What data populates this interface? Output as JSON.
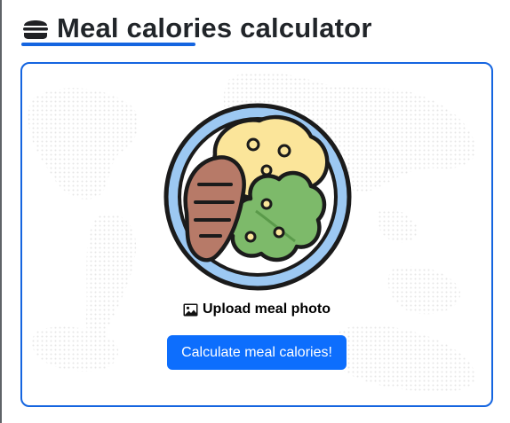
{
  "header": {
    "icon": "burger-icon",
    "title": "Meal calories calculator"
  },
  "card": {
    "illustration": "meal-plate-illustration",
    "background": "dotted-world-map",
    "upload": {
      "icon": "image-icon",
      "label": "Upload meal photo"
    },
    "calculate_button": {
      "label": "Calculate meal calories!"
    }
  },
  "colors": {
    "accent": "#1565e0",
    "button": "#0d6efd",
    "button_text": "#ffffff",
    "title_text": "#212529"
  }
}
